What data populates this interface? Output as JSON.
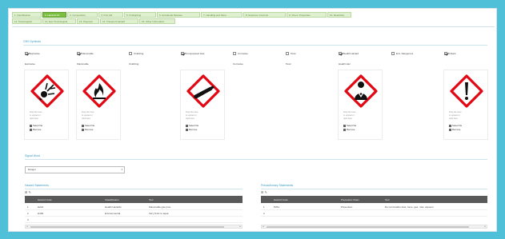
{
  "tabs": [
    {
      "label": "1. Identification"
    },
    {
      "label": "2. Hazards ID"
    },
    {
      "label": "3. Composition"
    },
    {
      "label": "4. First Aid"
    },
    {
      "label": "5. Firefighting"
    },
    {
      "label": "6. Accidental Release"
    },
    {
      "label": "7. Handling and Store"
    },
    {
      "label": "8. Exposure Controls"
    },
    {
      "label": "9. Chem. Properties"
    },
    {
      "label": "10. Reactivity"
    },
    {
      "label": "11. Toxicological"
    },
    {
      "label": "12. Eco-Toxicological"
    },
    {
      "label": "13. Disposal"
    },
    {
      "label": "14. Transport Hazard"
    },
    {
      "label": "15. Other Information"
    }
  ],
  "hazards_section": {
    "title": "GHS Symbols"
  },
  "hazards": [
    {
      "check": "Explosive",
      "name": "Explosive",
      "checked": true,
      "symbol": "explosive-icon",
      "has_image": true
    },
    {
      "check": "Flammable",
      "name": "Flammable",
      "checked": true,
      "symbol": "flame-icon",
      "has_image": true
    },
    {
      "check": "Oxidizing",
      "name": "Oxidizing",
      "checked": false,
      "symbol": "",
      "has_image": false
    },
    {
      "check": "Compressed Gas",
      "name": "",
      "checked": true,
      "symbol": "gas-cylinder-icon",
      "has_image": true
    },
    {
      "check": "Corrosive",
      "name": "Corrosive",
      "checked": false,
      "symbol": "",
      "has_image": false
    },
    {
      "check": "Toxic",
      "name": "Toxic",
      "checked": false,
      "symbol": "",
      "has_image": false
    },
    {
      "check": "Health Hazard",
      "name": "Health Haz",
      "checked": true,
      "symbol": "health-hazard-icon",
      "has_image": true
    },
    {
      "check": "Env. Dangerous",
      "name": "",
      "checked": false,
      "symbol": "",
      "has_image": false
    },
    {
      "check": "Irritant",
      "name": "",
      "checked": true,
      "symbol": "exclamation-icon",
      "has_image": true
    }
  ],
  "card_text": {
    "meta": [
      "Drop file here",
      "to upload or",
      "click here"
    ],
    "select_file": "Select file",
    "remove": "Remove"
  },
  "signal_word": {
    "title": "Signal Word",
    "value": "Danger"
  },
  "grids": [
    {
      "title": "Hazard Statements",
      "cols": [
        "Hazard Code",
        "Classification",
        "Text"
      ],
      "rows": [
        {
          "n": "1",
          "code": "H221",
          "cls": "Health Hazards",
          "text": "Flammable gas proc."
        },
        {
          "n": "2",
          "code": "H400",
          "cls": "Environmental",
          "text": "Very Toxic to aqua"
        },
        {
          "n": "3",
          "code": "",
          "cls": "",
          "text": ""
        }
      ]
    },
    {
      "title": "Precautionary Statements",
      "cols": [
        "Hazard Code",
        "Precaution Class",
        "Text"
      ],
      "rows": [
        {
          "n": "1",
          "code": "P261",
          "cls": "Prevention",
          "text": "Do not breathe dust, fume, gas, mist, vapours"
        },
        {
          "n": "2",
          "code": "",
          "cls": "",
          "text": ""
        }
      ]
    }
  ],
  "colors": {
    "accent": "#3a9ac4",
    "tab_active": "#7bbf3e",
    "ghs_red": "#e30613"
  }
}
